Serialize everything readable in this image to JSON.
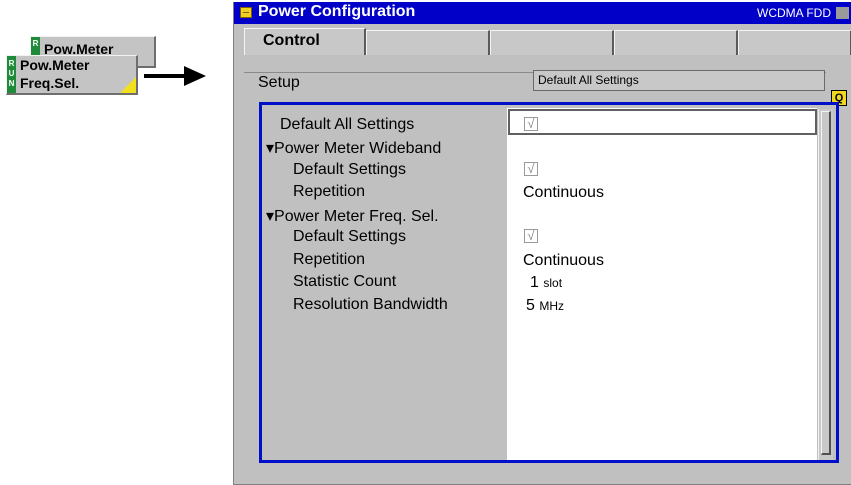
{
  "softkeys": {
    "back_label": "Pow.Meter",
    "front_line1": "Pow.Meter",
    "front_line2": "Freq.Sel.",
    "run_letters": "R U N",
    "back_run_letter": "R"
  },
  "window": {
    "title": "Power Configuration",
    "mode": "WCDMA FDD",
    "tabs": [
      "Control",
      "",
      "",
      "",
      ""
    ]
  },
  "setup": {
    "label": "Setup",
    "default_all_field": "Default All Settings"
  },
  "settings": [
    {
      "label": "Default All Settings",
      "value_type": "checkbox",
      "checked": true
    },
    {
      "label": "▾Power Meter Wideband",
      "value_type": "none"
    },
    {
      "label": "Default Settings",
      "value_type": "checkbox",
      "checked": true
    },
    {
      "label": "Repetition",
      "value": "Continuous"
    },
    {
      "label": "▾Power Meter Freq. Sel.",
      "value_type": "none"
    },
    {
      "label": "Default Settings",
      "value_type": "checkbox",
      "checked": true
    },
    {
      "label": "Repetition",
      "value": "Continuous"
    },
    {
      "label": "Statistic Count",
      "value": "1",
      "unit": "slot"
    },
    {
      "label": "Resolution Bandwidth",
      "value": "5",
      "unit": "MHz"
    }
  ],
  "check_glyph": "√",
  "colors": {
    "titlebar": "#0000c8",
    "panel_border": "#0010c8",
    "run_strip": "#1f8b3a",
    "softkey_corner": "#f0e020"
  }
}
